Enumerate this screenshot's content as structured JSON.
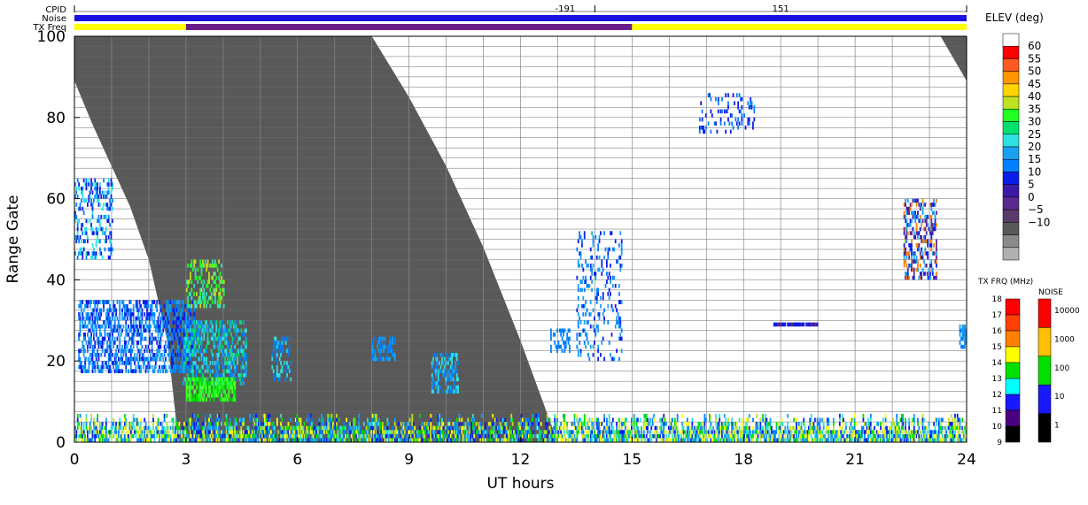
{
  "header": {
    "cpid_label": "CPID",
    "noise_label": "Noise",
    "txfreq_label": "TX Freq",
    "cpid_values": [
      {
        "text": "-191",
        "x_hour": 13.2
      },
      {
        "text": "151",
        "x_hour": 19.0
      }
    ],
    "cpid_change_hours": [
      0,
      14,
      24
    ],
    "txfreq_segments": [
      {
        "start": 0,
        "end": 3,
        "color": "#ffff00"
      },
      {
        "start": 3,
        "end": 15,
        "color": "#6a1d8a"
      },
      {
        "start": 15,
        "end": 24,
        "color": "#ffff00"
      }
    ],
    "noise_color": "#1a10e0"
  },
  "chart_data": {
    "type": "heatmap",
    "title": "",
    "xlabel": "UT hours",
    "ylabel": "Range Gate",
    "xlim": [
      0,
      24
    ],
    "ylim": [
      0,
      100
    ],
    "xticks": [
      0,
      3,
      6,
      9,
      12,
      15,
      18,
      21,
      24
    ],
    "yticks": [
      0,
      20,
      40,
      60,
      80,
      100
    ],
    "grid": true,
    "night_shading": {
      "color": "#595959",
      "description": "Unlit (gray) region bounded by left and right edges",
      "left_edge": [
        [
          0,
          89
        ],
        [
          0.5,
          78
        ],
        [
          1,
          68
        ],
        [
          1.5,
          58
        ],
        [
          2,
          45
        ],
        [
          2.5,
          25
        ],
        [
          2.8,
          0
        ]
      ],
      "right_edge": [
        [
          8,
          100
        ],
        [
          9,
          85
        ],
        [
          10,
          68
        ],
        [
          11,
          48
        ],
        [
          12,
          25
        ],
        [
          13,
          0
        ]
      ],
      "second_region": {
        "start_hour": 23.3,
        "points": [
          [
            23.3,
            100
          ],
          [
            24,
            100
          ],
          [
            24,
            89
          ]
        ]
      }
    },
    "scatter_blobs": [
      {
        "x": [
          0,
          1
        ],
        "y": [
          45,
          65
        ],
        "colors": [
          "#0b1de8",
          "#0080ff",
          "#2fe0e0"
        ],
        "density": 0.35
      },
      {
        "x": [
          0.1,
          3.2
        ],
        "y": [
          17,
          35
        ],
        "colors": [
          "#0080ff",
          "#1aa0f0",
          "#0b1de8"
        ],
        "density": 0.55
      },
      {
        "x": [
          2.9,
          4.6
        ],
        "y": [
          14,
          30
        ],
        "colors": [
          "#2fe0e0",
          "#1aa0f0",
          "#00e070",
          "#0080ff"
        ],
        "density": 0.5
      },
      {
        "x": [
          3.0,
          4.3
        ],
        "y": [
          10,
          16
        ],
        "colors": [
          "#00e000",
          "#20ff20",
          "#50ff30"
        ],
        "density": 0.7
      },
      {
        "x": [
          3.0,
          4.0
        ],
        "y": [
          33,
          45
        ],
        "colors": [
          "#20ff20",
          "#c0e020",
          "#30e0c0"
        ],
        "density": 0.35
      },
      {
        "x": [
          5.3,
          5.8
        ],
        "y": [
          15,
          26
        ],
        "colors": [
          "#0080ff",
          "#2fe0e0"
        ],
        "density": 0.4
      },
      {
        "x": [
          8.0,
          8.6
        ],
        "y": [
          20,
          26
        ],
        "colors": [
          "#0080ff",
          "#1aa0f0"
        ],
        "density": 0.5
      },
      {
        "x": [
          9.6,
          10.3
        ],
        "y": [
          12,
          22
        ],
        "colors": [
          "#0080ff",
          "#1aa0f0",
          "#2fe0e0"
        ],
        "density": 0.5
      },
      {
        "x": [
          12.8,
          13.3
        ],
        "y": [
          22,
          28
        ],
        "colors": [
          "#0080ff"
        ],
        "density": 0.4
      },
      {
        "x": [
          13.5,
          14.7
        ],
        "y": [
          20,
          52
        ],
        "colors": [
          "#0080ff",
          "#1aa0f0",
          "#0b1de8"
        ],
        "density": 0.2
      },
      {
        "x": [
          16.8,
          18.3
        ],
        "y": [
          76,
          86
        ],
        "colors": [
          "#0b1de8",
          "#0080ff"
        ],
        "density": 0.2
      },
      {
        "x": [
          22.3,
          23.2
        ],
        "y": [
          40,
          60
        ],
        "colors": [
          "#0b1de8",
          "#5b2a91",
          "#1aa0f0",
          "#ff8000"
        ],
        "density": 0.45
      },
      {
        "x": [
          23.8,
          24.0
        ],
        "y": [
          23,
          29
        ],
        "colors": [
          "#0080ff",
          "#1aa0f0"
        ],
        "density": 0.8
      },
      {
        "x": [
          18.8,
          20.0
        ],
        "y": [
          28.5,
          29.5
        ],
        "colors": [
          "#5b2a91",
          "#0b1de8"
        ],
        "density": 0.9
      }
    ],
    "ground_band": {
      "x": [
        0,
        24
      ],
      "y": [
        0,
        7
      ],
      "colors": [
        "#00e000",
        "#2fe0e0",
        "#1aa0f0",
        "#ffff00",
        "#c0e020",
        "#0080ff",
        "#0b1de8"
      ]
    },
    "elev_colorbar": {
      "title": "ELEV (deg)",
      "labels": [
        "60",
        "55",
        "50",
        "45",
        "40",
        "35",
        "30",
        "25",
        "20",
        "15",
        "10",
        "5",
        "0",
        "−5",
        "−10"
      ],
      "colors": [
        "#ffffff",
        "#ff0000",
        "#ff5a20",
        "#ff9600",
        "#ffd400",
        "#c0e020",
        "#20ff20",
        "#00e070",
        "#2fe0e0",
        "#1aa0f0",
        "#0080ff",
        "#0b1de8",
        "#3b1aa8",
        "#5b2a91",
        "#5a3a6a",
        "#595959",
        "#8a8a8a",
        "#b0b0b0"
      ]
    },
    "txfrq_colorbar": {
      "title": "TX FRQ (MHz)",
      "labels": [
        "18",
        "17",
        "16",
        "15",
        "14",
        "13",
        "12",
        "11",
        "10",
        "9"
      ],
      "colors": [
        "#ff0000",
        "#ff4000",
        "#ff8000",
        "#ffff00",
        "#00e000",
        "#00ffff",
        "#1818ff",
        "#4b0082",
        "#000000"
      ]
    },
    "noise_colorbar": {
      "title": "NOISE",
      "labels": [
        "10000",
        "1000",
        "100",
        "10",
        "1"
      ],
      "colors": [
        "#ff0000",
        "#ffc000",
        "#00e000",
        "#1818ff",
        "#000000"
      ]
    }
  }
}
